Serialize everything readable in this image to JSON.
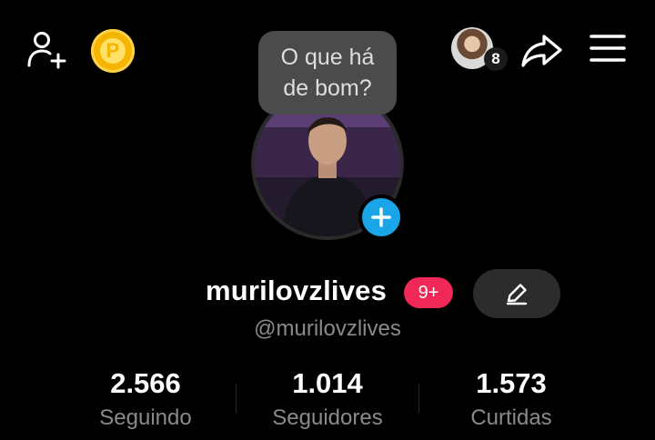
{
  "header": {
    "add_friend_icon": "person-add-icon",
    "coin_icon": "coin-icon",
    "coin_letter": "P",
    "friends_count": "8",
    "share_icon": "share-icon",
    "menu_icon": "hamburger-menu-icon"
  },
  "bubble": {
    "line1": "O que há",
    "line2": "de bom?"
  },
  "profile": {
    "username": "murilovzlives",
    "notification_badge": "9+",
    "handle": "@murilovzlives",
    "edit_icon": "pencil-icon",
    "add_icon": "plus-icon"
  },
  "stats": [
    {
      "value": "2.566",
      "label": "Seguindo"
    },
    {
      "value": "1.014",
      "label": "Seguidores"
    },
    {
      "value": "1.573",
      "label": "Curtidas"
    }
  ],
  "colors": {
    "background": "#000000",
    "badge": "#ef2857",
    "add_button": "#1aa5e8",
    "coin": "#f4b400"
  }
}
